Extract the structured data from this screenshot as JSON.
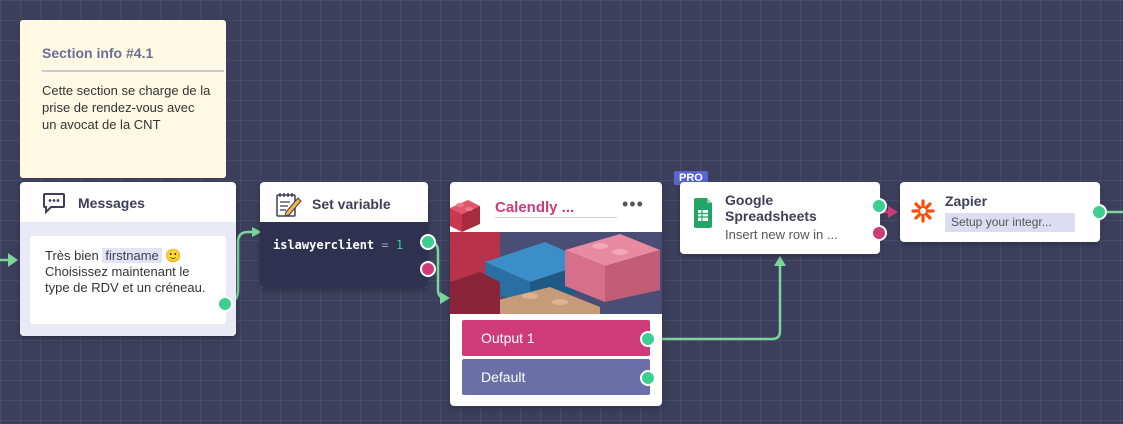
{
  "section_note": {
    "title": "Section info #4.1",
    "body": "Cette section se charge de la prise de rendez-vous avec un avocat de la CNT"
  },
  "messages": {
    "title": "Messages",
    "text_before": "Très bien ",
    "variable": "firstname",
    "emoji": "🙂",
    "text_after": "Choisissez maintenant le type de RDV et un créneau."
  },
  "set_variable": {
    "title": "Set variable",
    "var_name": "islawyerclient",
    "operator": "=",
    "value": "1"
  },
  "calendly": {
    "title": "Calendly ...",
    "more": "•••",
    "outputs": [
      {
        "label": "Output 1",
        "color": "#cf3b78"
      },
      {
        "label": "Default",
        "color": "#6b6fa7"
      }
    ]
  },
  "google_sheets": {
    "badge": "PRO",
    "title": "Google Spreadsheets",
    "subtitle": "Insert new row in ..."
  },
  "zapier": {
    "title": "Zapier",
    "subtitle": "Setup your integr..."
  },
  "colors": {
    "canvas": "#3c3f5c",
    "connector": "#7bd69a",
    "success_port": "#3ccf91",
    "error_port": "#cf3b78",
    "accent_pink": "#cf3b78",
    "pro_badge": "#5966cf"
  }
}
